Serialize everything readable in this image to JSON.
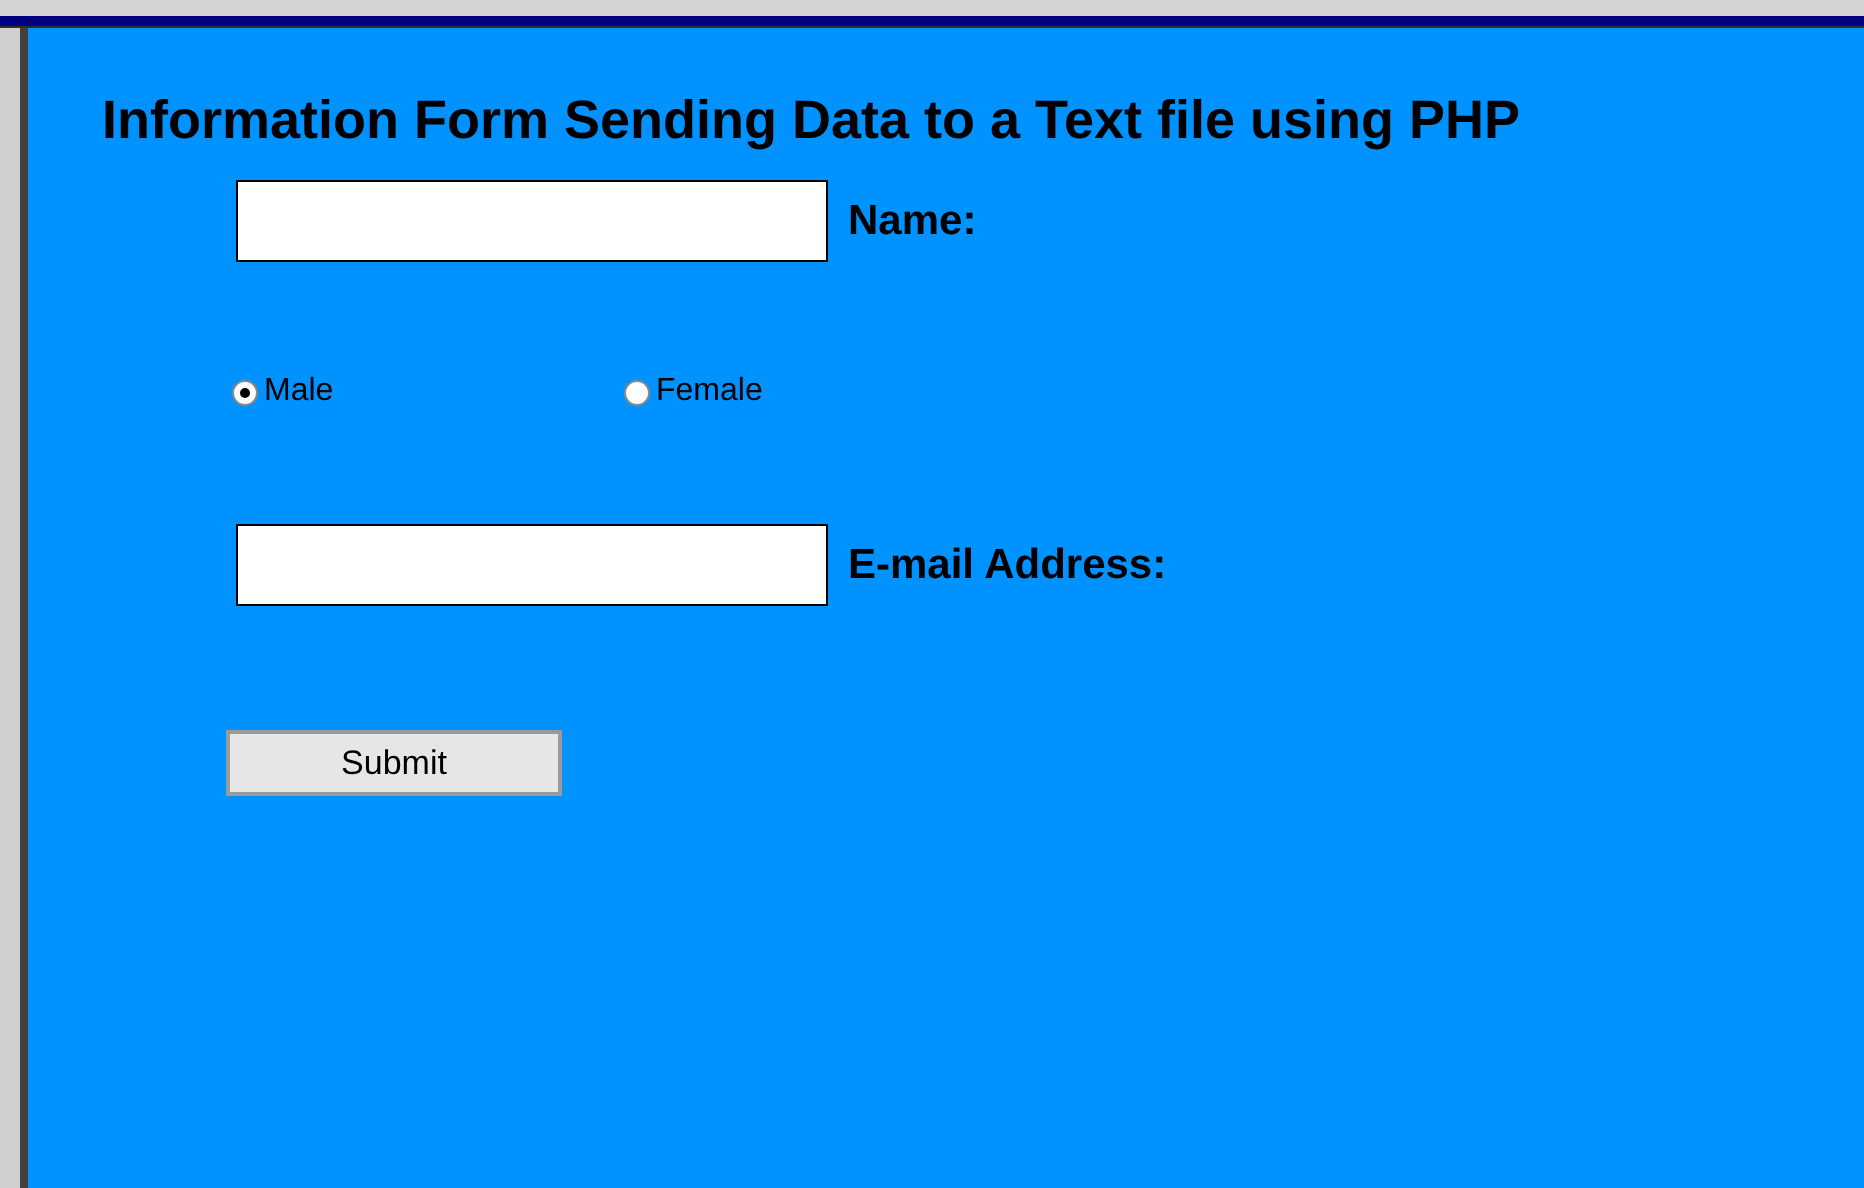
{
  "title": "Information Form Sending Data to a Text file using PHP",
  "name_field": {
    "label": "Name:"
  },
  "gender": [
    {
      "label": "Male",
      "selected": true
    },
    {
      "label": "Female",
      "selected": false
    }
  ],
  "email_field": {
    "label": "E-mail Address:"
  },
  "submit": {
    "label": "Submit"
  }
}
